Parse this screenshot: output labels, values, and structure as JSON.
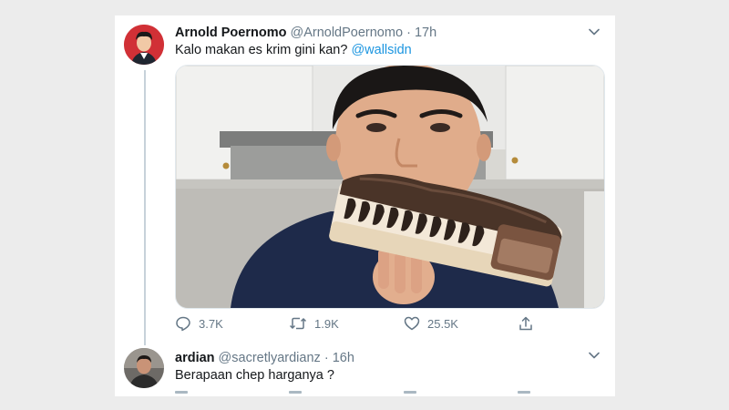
{
  "tweet": {
    "name": "Arnold Poernomo",
    "handle": "@ArnoldPoernomo",
    "separator": "·",
    "time": "17h",
    "text": "Kalo makan es krim gini kan?",
    "mention": "@wallsidn",
    "actions": {
      "reply_count": "3.7K",
      "retweet_count": "1.9K",
      "like_count": "25.5K"
    },
    "icons": {
      "reply": "reply-icon",
      "retweet": "retweet-icon",
      "like": "heart-icon",
      "share": "share-icon",
      "menu": "chevron-down-icon"
    }
  },
  "reply": {
    "name": "ardian",
    "handle": "@sacretlyardianz",
    "separator": "·",
    "time": "16h",
    "text": "Berapaan chep harganya ?"
  },
  "colors": {
    "text": "#14171a",
    "secondary": "#657786",
    "link": "#1b95e0",
    "thread_line": "#c7d2da"
  }
}
